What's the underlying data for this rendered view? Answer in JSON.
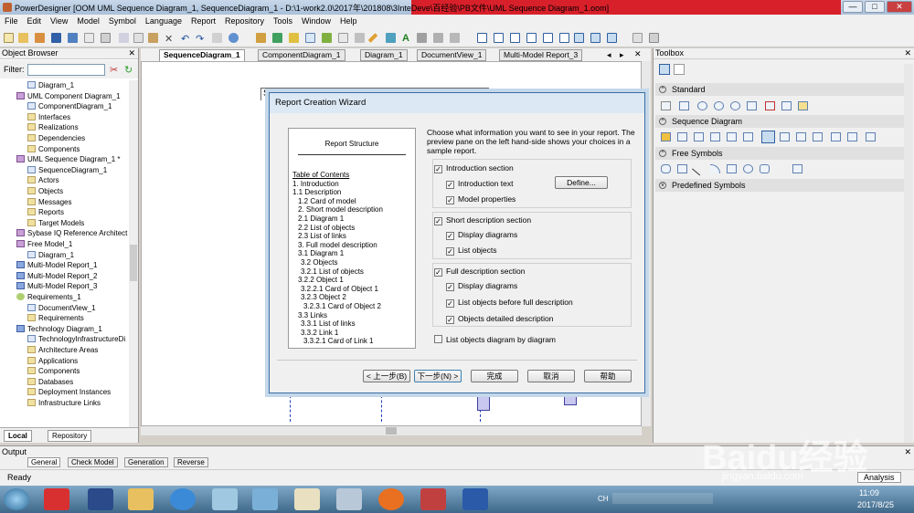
{
  "window": {
    "title": "PowerDesigner [OOM UML Sequence Diagram_1, SequenceDiagram_1 - D:\\1-work2.0\\2017年\\201808\\3InteDeve\\百经验\\PB文件\\UML Sequence Diagram_1.oom]",
    "min": "—",
    "max": "□",
    "close": "✕"
  },
  "menu": [
    "File",
    "Edit",
    "View",
    "Model",
    "Symbol",
    "Language",
    "Report",
    "Repository",
    "Tools",
    "Window",
    "Help"
  ],
  "object_browser": {
    "title": "Object Browser",
    "close": "✕",
    "filter_label": "Filter:",
    "tree": [
      {
        "label": "Diagram_1",
        "indent": 30,
        "icon": "dia"
      },
      {
        "label": "UML Component Diagram_1",
        "indent": 18,
        "icon": "pk"
      },
      {
        "label": "ComponentDiagram_1",
        "indent": 30,
        "icon": "dia"
      },
      {
        "label": "Interfaces",
        "indent": 30,
        "icon": "fold"
      },
      {
        "label": "Realizations",
        "indent": 30,
        "icon": "fold"
      },
      {
        "label": "Dependencies",
        "indent": 30,
        "icon": "fold"
      },
      {
        "label": "Components",
        "indent": 30,
        "icon": "fold"
      },
      {
        "label": "UML Sequence Diagram_1 *",
        "indent": 18,
        "icon": "pk"
      },
      {
        "label": "SequenceDiagram_1",
        "indent": 30,
        "icon": "dia"
      },
      {
        "label": "Actors",
        "indent": 30,
        "icon": "fold"
      },
      {
        "label": "Objects",
        "indent": 30,
        "icon": "fold"
      },
      {
        "label": "Messages",
        "indent": 30,
        "icon": "fold"
      },
      {
        "label": "Reports",
        "indent": 30,
        "icon": "fold"
      },
      {
        "label": "Target Models",
        "indent": 30,
        "icon": "fold"
      },
      {
        "label": "Sybase IQ Reference Architect",
        "indent": 18,
        "icon": "pk"
      },
      {
        "label": "Free Model_1",
        "indent": 18,
        "icon": "pk"
      },
      {
        "label": "Diagram_1",
        "indent": 30,
        "icon": "dia"
      },
      {
        "label": "Multi-Model Report_1",
        "indent": 18,
        "icon": "mm"
      },
      {
        "label": "Multi-Model Report_2",
        "indent": 18,
        "icon": "mm"
      },
      {
        "label": "Multi-Model Report_3",
        "indent": 18,
        "icon": "mm"
      },
      {
        "label": "Requirements_1",
        "indent": 18,
        "icon": "gr"
      },
      {
        "label": "DocumentView_1",
        "indent": 30,
        "icon": "dia"
      },
      {
        "label": "Requirements",
        "indent": 30,
        "icon": "fold"
      },
      {
        "label": "Technology Diagram_1",
        "indent": 18,
        "icon": "mm"
      },
      {
        "label": "TechnologyInfrastructureDi",
        "indent": 30,
        "icon": "dia"
      },
      {
        "label": "Architecture Areas",
        "indent": 30,
        "icon": "fold"
      },
      {
        "label": "Applications",
        "indent": 30,
        "icon": "fold"
      },
      {
        "label": "Components",
        "indent": 30,
        "icon": "fold"
      },
      {
        "label": "Databases",
        "indent": 30,
        "icon": "fold"
      },
      {
        "label": "Deployment Instances",
        "indent": 30,
        "icon": "fold"
      },
      {
        "label": "Infrastructure Links",
        "indent": 30,
        "icon": "fold"
      }
    ],
    "tabs": [
      "Local",
      "Repository"
    ]
  },
  "doc_tabs": [
    "SequenceDiagram_1",
    "ComponentDiagram_1",
    "Diagram_1",
    "DocumentView_1",
    "Multi-Model Report_3"
  ],
  "canvas": {
    "frame_title": "SequenceDiagram_1"
  },
  "toolbox": {
    "title": "Toolbox",
    "close": "✕",
    "sections": [
      "Standard",
      "Sequence Diagram",
      "Free Symbols",
      "Predefined Symbols"
    ]
  },
  "output": {
    "title": "Output",
    "tabs": [
      "General",
      "Check Model",
      "Generation",
      "Reverse"
    ]
  },
  "status": {
    "left": "Ready",
    "right": "Analysis"
  },
  "taskbar": {
    "lang": "CH",
    "time": "11:09",
    "date": "2017/8/25"
  },
  "watermark": {
    "brand": "Baidu经验",
    "url": "jingyan.baidu.com"
  },
  "dialog": {
    "title": "Report Creation Wizard",
    "preview_title": "Report Structure",
    "preview_lines": [
      "Table of Contents",
      "1. Introduction",
      "1.1 Description",
      "1.2 Card of model",
      "2. Short model description",
      "2.1 Diagram 1",
      "2.2 List of objects",
      "2.3 List of links",
      "3. Full model description",
      "3.1 Diagram 1",
      "3.2 Objects",
      "3.2.1 List of objects",
      "3.2.2 Object 1",
      "3.2.2.1 Card of Object 1",
      "3.2.3 Object 2",
      "3.2.3.1 Card of Object 2",
      "3.3 Links",
      "3.3.1 List of links",
      "3.3.2 Link 1",
      "3.3.2.1 Card of Link 1"
    ],
    "description": "Choose what information you want to see in your report. The preview pane on the left hand-side shows your choices in a sample report.",
    "intro_section": "Introduction section",
    "intro_text": "Introduction text",
    "define_button": "Define...",
    "model_properties": "Model properties",
    "short_section": "Short description section",
    "display_diagrams": "Display diagrams",
    "list_objects": "List objects",
    "full_section": "Full description section",
    "display_diagrams_full": "Display diagrams",
    "list_objects_before": "List objects before full description",
    "objects_detailed": "Objects detailed description",
    "list_by_diagram": "List objects diagram by diagram",
    "buttons": {
      "back": "< 上一步(B)",
      "next": "下一步(N) >",
      "finish": "完成",
      "cancel": "取消",
      "help": "帮助"
    },
    "check": "✓"
  }
}
